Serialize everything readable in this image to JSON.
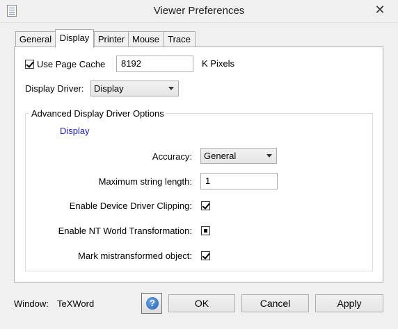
{
  "window": {
    "title": "Viewer Preferences",
    "close_glyph": "✕"
  },
  "tabs": [
    {
      "label": "General",
      "active": false
    },
    {
      "label": "Display",
      "active": true
    },
    {
      "label": "Printer",
      "active": false
    },
    {
      "label": "Mouse",
      "active": false
    },
    {
      "label": "Trace",
      "active": false
    }
  ],
  "display": {
    "use_page_cache": {
      "label": "Use Page Cache",
      "checked": true
    },
    "cache_size": {
      "value": "8192",
      "unit": "K Pixels"
    },
    "display_driver": {
      "label": "Display Driver:",
      "selected": "Display"
    },
    "advanced": {
      "group_title": "Advanced Display Driver Options",
      "driver_name": "Display",
      "accuracy": {
        "label": "Accuracy:",
        "selected": "General"
      },
      "max_string_length": {
        "label": "Maximum string length:",
        "value": "1"
      },
      "enable_clipping": {
        "label": "Enable Device Driver Clipping:",
        "state": "checked"
      },
      "enable_nt_world": {
        "label": "Enable NT World Transformation:",
        "state": "indeterminate"
      },
      "mark_mistransformed": {
        "label": "Mark mistransformed object:",
        "state": "checked"
      }
    }
  },
  "footer": {
    "window_label": "Window:",
    "window_value": "TeXWord",
    "help_glyph": "?",
    "ok_label": "OK",
    "cancel_label": "Cancel",
    "apply_label": "Apply"
  },
  "colors": {
    "link_blue": "#1a1adb",
    "panel_bg": "#ffffff",
    "window_bg": "#f0f0f0"
  }
}
